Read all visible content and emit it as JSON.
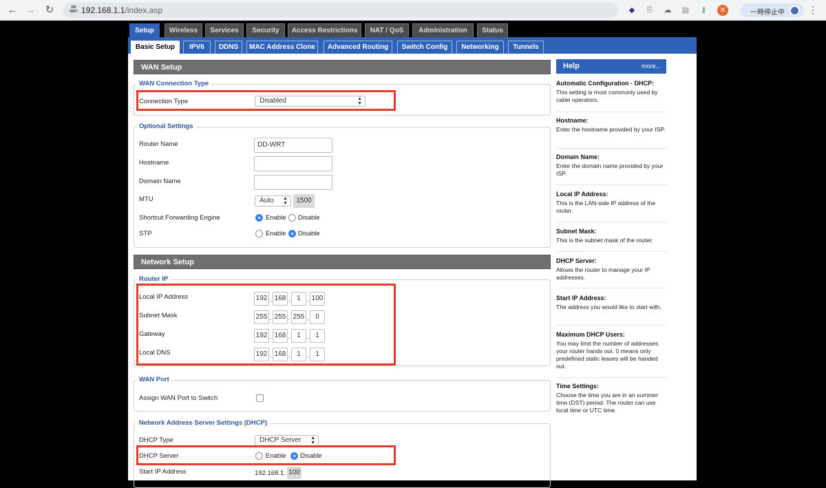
{
  "browser": {
    "url_host": "192.168.1.1",
    "url_path": "/index.asp",
    "site_icon_text": "DD-WRT",
    "pause_label": "一時停止中",
    "icons": [
      "back-icon",
      "forward-icon",
      "reload-icon",
      "extension-icon",
      "menu-icon"
    ]
  },
  "nav": {
    "top_tabs": [
      "Setup",
      "Wireless",
      "Services",
      "Security",
      "Access Restrictions",
      "NAT / QoS",
      "Administration",
      "Status"
    ],
    "sub_tabs": [
      "Basic Setup",
      "IPV6",
      "DDNS",
      "MAC Address Clone",
      "Advanced Routing",
      "Switch Config",
      "Networking",
      "Tunnels"
    ]
  },
  "wan": {
    "section_title": "WAN Setup",
    "connection_legend": "WAN Connection Type",
    "connection_type_label": "Connection Type",
    "connection_type_value": "Disabled",
    "optional_legend": "Optional Settings",
    "router_name_label": "Router Name",
    "router_name_value": "DD-WRT",
    "hostname_label": "Hostname",
    "domain_label": "Domain Name",
    "mtu_label": "MTU",
    "mtu_mode": "Auto",
    "mtu_value": "1500",
    "sfe_label": "Shortcut Forwarding Engine",
    "stp_label": "STP",
    "enable_label": "Enable",
    "disable_label": "Disable"
  },
  "network": {
    "section_title": "Network Setup",
    "router_ip_legend": "Router IP",
    "local_ip_label": "Local IP Address",
    "local_ip": [
      "192",
      "168",
      "1",
      "100"
    ],
    "subnet_label": "Subnet Mask",
    "subnet": [
      "255",
      "255",
      "255",
      "0"
    ],
    "gateway_label": "Gateway",
    "gateway": [
      "192",
      "168",
      "1",
      "1"
    ],
    "dns_label": "Local DNS",
    "dns": [
      "192",
      "168",
      "1",
      "1"
    ],
    "wan_port_legend": "WAN Port",
    "assign_wan_label": "Assign WAN Port to Switch",
    "dhcp_legend": "Network Address Server Settings (DHCP)",
    "dhcp_type_label": "DHCP Type",
    "dhcp_type_value": "DHCP Server",
    "dhcp_server_label": "DHCP Server",
    "start_ip_label": "Start IP Address",
    "start_ip_prefix": "192.168.1.",
    "start_ip_last": "100"
  },
  "help": {
    "title": "Help",
    "more": "more...",
    "items": [
      {
        "title": "Automatic Configuration - DHCP:",
        "text": "This setting is most commonly used by cable operators."
      },
      {
        "title": "Hostname:",
        "text": "Enter the hostname provided by your ISP."
      },
      {
        "title": "Domain Name:",
        "text": "Enter the domain name provided by your ISP."
      },
      {
        "title": "Local IP Address:",
        "text": "This is the LAN-side IP address of the router."
      },
      {
        "title": "Subnet Mask:",
        "text": "This is the subnet mask of the router."
      },
      {
        "title": "DHCP Server:",
        "text": "Allows the router to manage your IP addresses."
      },
      {
        "title": "Start IP Address:",
        "text": "The address you would like to start with."
      },
      {
        "title": "Maximum DHCP Users:",
        "text": "You may limit the number of addresses your router hands out. 0 means only predefined static leases will be handed out."
      },
      {
        "title": "Time Settings:",
        "text": "Choose the time you are in an summer time (DST) period. The router can use local time or UTC time."
      }
    ]
  },
  "colors": {
    "active_blue": "#2f63b8",
    "highlight_red": "#e23b28",
    "radio_on": "#3a82f7"
  }
}
